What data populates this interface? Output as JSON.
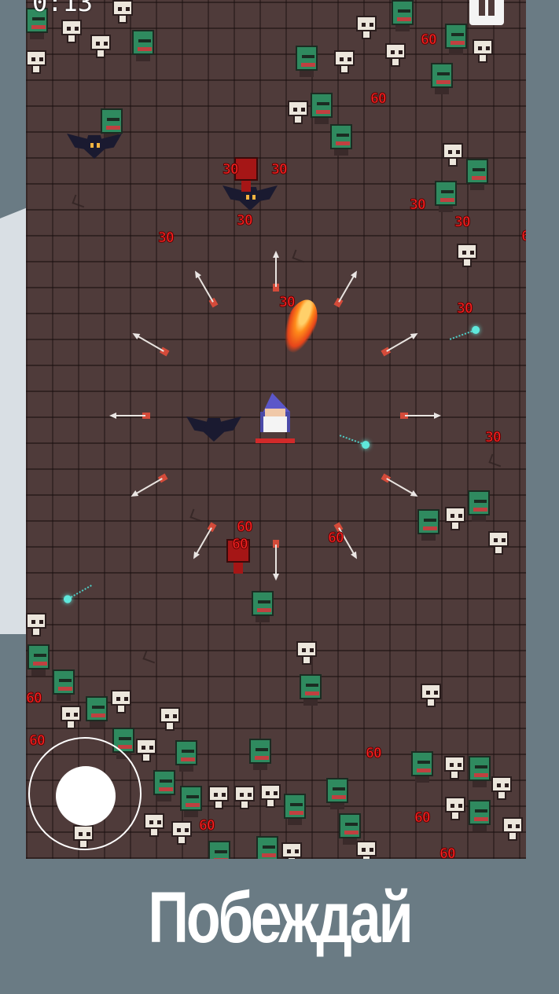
{
  "hud": {
    "timer": "0:13",
    "pause_icon": "pause-icon"
  },
  "damage_numbers": [
    "30",
    "30",
    "30",
    "60",
    "30",
    "60",
    "30",
    "30",
    "30",
    "30",
    "60",
    "60",
    "60",
    "60",
    "60",
    "30",
    "60",
    "60",
    "60",
    "60",
    "60"
  ],
  "caption": "Побеждай",
  "colors": {
    "floor": "#4f3b3a",
    "background": "#6a7b84",
    "damage": "#ff2424",
    "zombie": "#2f8a5f",
    "skull": "#ece6dc"
  }
}
